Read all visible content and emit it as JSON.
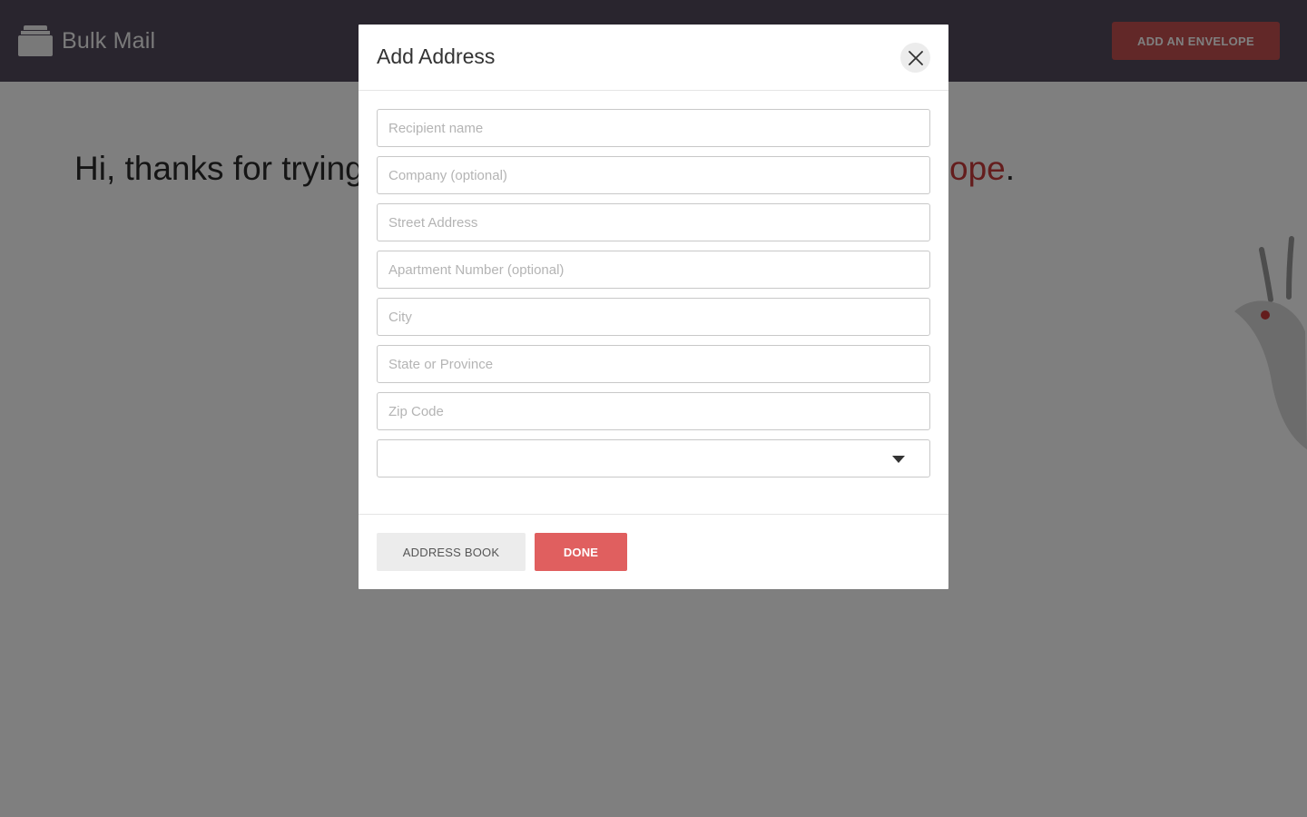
{
  "header": {
    "brand_name": "Bulk Mail",
    "add_envelope_label": "ADD AN ENVELOPE"
  },
  "main": {
    "greeting_start": "Hi, thanks for trying",
    "greeting_link_fragment": "ope",
    "greeting_end": "."
  },
  "modal": {
    "title": "Add Address",
    "fields": {
      "recipient_placeholder": "Recipient name",
      "company_placeholder": "Company (optional)",
      "street_placeholder": "Street Address",
      "apartment_placeholder": "Apartment Number (optional)",
      "city_placeholder": "City",
      "state_placeholder": "State or Province",
      "zip_placeholder": "Zip Code",
      "country_selected": ""
    },
    "footer": {
      "address_book_label": "ADDRESS BOOK",
      "done_label": "DONE"
    }
  },
  "colors": {
    "header_bg": "#524a5c",
    "accent_red": "#c55050",
    "done_red": "#e05f5f",
    "overlay": "rgba(0,0,0,0.5)"
  },
  "icons": {
    "brand": "envelope-stack-icon",
    "close": "close-icon",
    "select_caret": "chevron-down-icon"
  }
}
